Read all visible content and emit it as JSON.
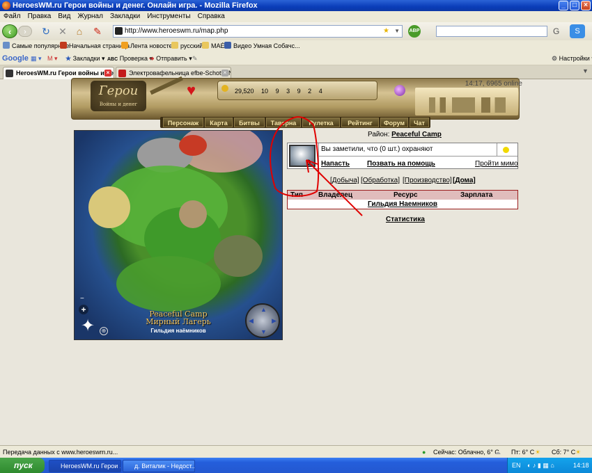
{
  "window": {
    "title": "HeroesWM.ru Герои войны и денег. Онлайн игра. - Mozilla Firefox",
    "minimize": "_",
    "maximize": "□",
    "close": "×"
  },
  "menu": [
    "Файл",
    "Правка",
    "Вид",
    "Журнал",
    "Закладки",
    "Инструменты",
    "Справка"
  ],
  "nav": {
    "url": "http://www.heroeswm.ru/map.php",
    "abp": "ABP"
  },
  "bookmarks": [
    "Самые популярные",
    "Начальная страница",
    "Лента новостей",
    "русский",
    "MAÉ",
    "Видео Умная Собачс..."
  ],
  "google_toolbar": {
    "logo": "Google",
    "bookmarks": "Закладки",
    "check": "Проверка",
    "send": "Отправить",
    "settings": "Настройки"
  },
  "tabs": [
    {
      "label": "HeroesWM.ru Герои войны и ден..."
    },
    {
      "label": "Электровафельница efbe-Schott ZN ..."
    }
  ],
  "game": {
    "logo_title": "Герои",
    "logo_sub": "Войны и денег",
    "clock": "14:17, 6965 online",
    "resources": [
      "29,520",
      "10",
      "9",
      "3",
      "9",
      "2",
      "4"
    ],
    "nav": [
      "Персонаж",
      "Карта",
      "Битвы",
      "Таверна",
      "Рулетка",
      "Рейтинг",
      "Форум",
      "Чат"
    ]
  },
  "map": {
    "zoom_in": "+",
    "zoom_out": "−",
    "label_en": "Peaceful Camp",
    "label_ru": "Мирный Лагерь",
    "guild": "Гильдия наёмников"
  },
  "district": {
    "label": "Район:",
    "name": "Peaceful Camp"
  },
  "guard": {
    "count": "0",
    "notice": "Вы заметили, что (0 шт.) охраняют",
    "attack": "Напасть",
    "call_help": "Позвать на помощь",
    "pass_by": "Пройти мимо"
  },
  "sections": [
    "[Добыча]",
    "[Обработка]",
    "[Производство]",
    "[Дома]"
  ],
  "table": {
    "headers": [
      "Тип",
      "Владелец",
      "Ресурс",
      "Зарплата"
    ],
    "row": "Гильдия Наемников"
  },
  "stats_link": "Статистика",
  "status": {
    "text": "Передача данных с www.heroeswm.ru...",
    "weather": "Сейчас: Облачно, 6° С",
    "fri": "Пт: 6° С",
    "sat": "Сб: 7° С"
  },
  "taskbar": {
    "start": "пуск",
    "tasks": [
      "HeroesWM.ru Герои ...",
      "д. Виталик - Недост..."
    ],
    "lang": "EN",
    "time": "14:18"
  },
  "colors": {
    "xp_blue": "#0a3db9",
    "game_gold": "#d6c393",
    "table_border": "#9a1c1c",
    "annotation_red": "#e00000"
  }
}
